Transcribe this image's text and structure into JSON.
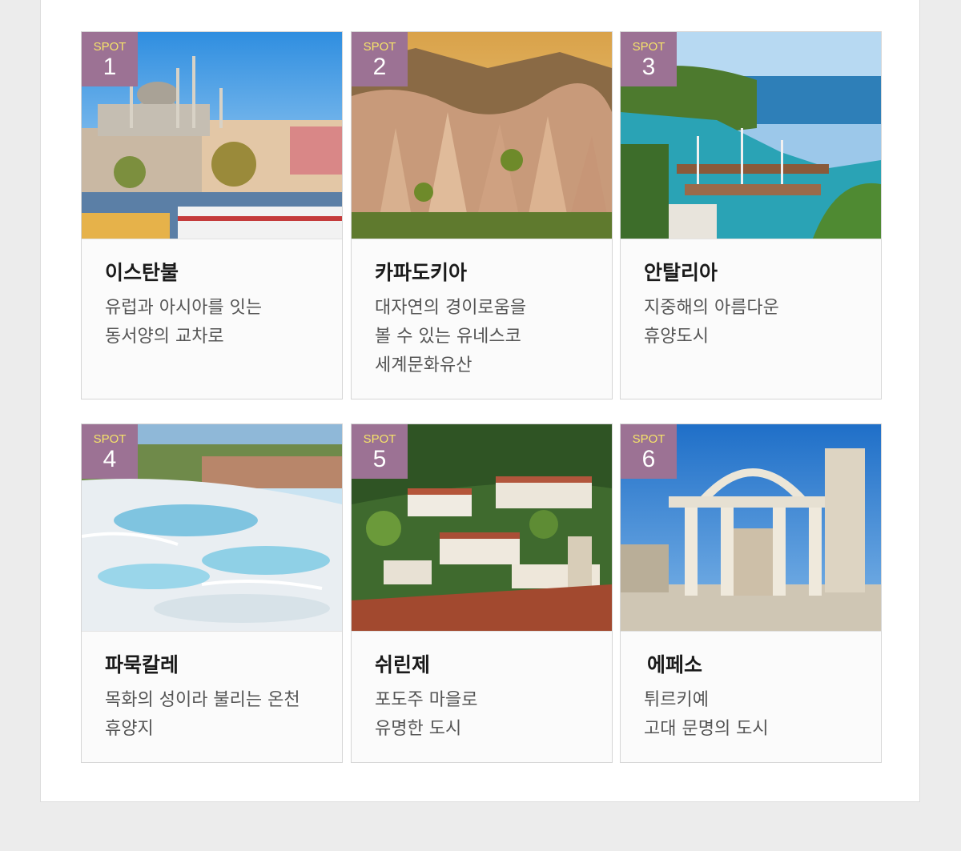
{
  "badge": {
    "spot_label": "SPOT"
  },
  "spots": [
    {
      "number": "1",
      "title": "이스탄불",
      "desc": [
        "유럽과 아시아를 잇는",
        "동서양의 교차로"
      ]
    },
    {
      "number": "2",
      "title": "카파도키아",
      "desc": [
        "대자연의 경이로움을",
        "볼 수 있는 유네스코",
        "세계문화유산"
      ]
    },
    {
      "number": "3",
      "title": "안탈리아",
      "desc": [
        "지중해의 아름다운",
        "휴양도시"
      ]
    },
    {
      "number": "4",
      "title": "파묵칼레",
      "desc": [
        "목화의 성이라 불리는 온천",
        "휴양지"
      ]
    },
    {
      "number": "5",
      "title": "쉬린제",
      "desc": [
        "포도주 마을로",
        "유명한 도시"
      ]
    },
    {
      "number": "6",
      "title": "에페소",
      "desc": [
        "튀르키예",
        "고대 문명의 도시"
      ]
    }
  ],
  "colors": {
    "badge_bg": "#9c7294",
    "spot_text": "#f5e36a",
    "page_bg": "#ececec"
  }
}
